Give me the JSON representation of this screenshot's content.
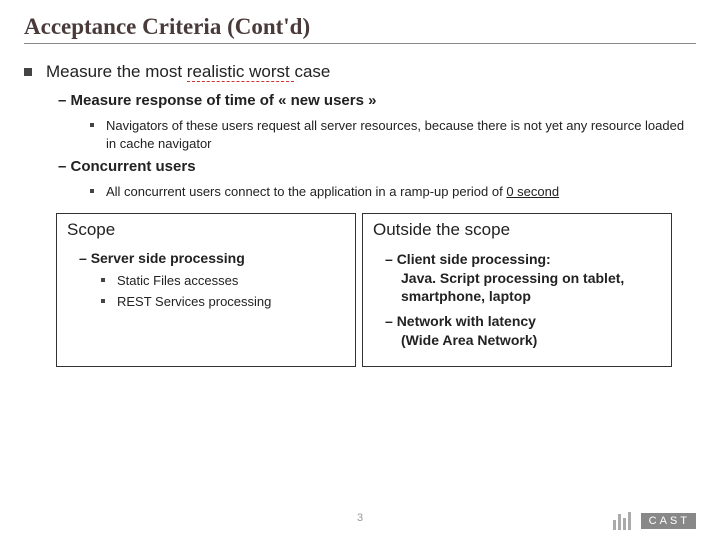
{
  "title": "Acceptance Criteria (Cont'd)",
  "b1_pre": "Measure the most ",
  "b1_underlined": "realistic worst ",
  "b1_post": "case",
  "b2_1": "Measure response of time of « new users »",
  "b3_1": "Navigators of these users request all server resources, because there is not yet any resource loaded in cache navigator",
  "b2_2": "Concurrent users",
  "b3_2_pre": "All concurrent users connect to the application in a ramp-up period of ",
  "b3_2_u": "0 second",
  "scope": {
    "title": "Scope",
    "b2": "Server side processing",
    "b3a": "Static Files accesses",
    "b3b": "REST Services processing"
  },
  "outside": {
    "title": "Outside the scope",
    "b2a_line1": "Client side processing:",
    "b2a_line2": "Java. Script processing on tablet, smartphone, laptop",
    "b2b_line1": "Network with latency",
    "b2b_line2": "(Wide Area Network)"
  },
  "page_number": "3",
  "brand": "CAST"
}
